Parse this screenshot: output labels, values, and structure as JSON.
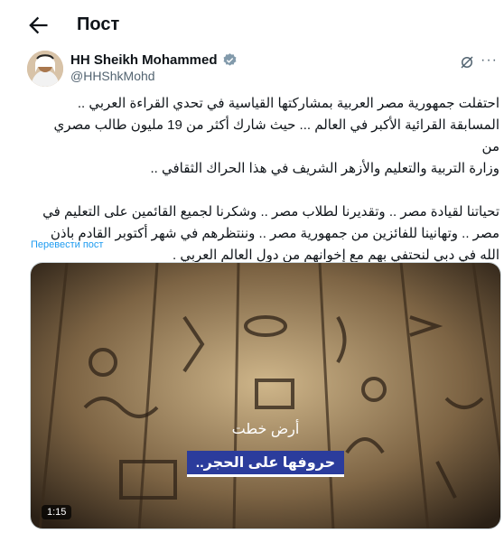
{
  "header": {
    "title": "Пост"
  },
  "author": {
    "name": "HH Sheikh Mohammed",
    "handle": "@HHShkMohd"
  },
  "tweet": {
    "text": "احتفلت جمهورية مصر العربية بمشاركتها القياسية في تحدي القراءة العربي ..\nالمسابقة القرائية الأكبر في العالم ... حيث شارك أكثر من 19 مليون طالب مصري من\nوزارة التربية والتعليم والأزهر الشريف في هذا الحراك الثقافي ..\n\nتحياتنا لقيادة مصر .. وتقديرنا لطلاب مصر .. وشكرنا لجميع القائمين على التعليم في\nمصر .. وتهانينا للفائزين من جمهورية مصر .. وننتظرهم في شهر أكتوبر القادم باذن\nالله في دبي لنحتفي بهم مع إخوانهم من دول العالم العربي ."
  },
  "translate_label": "Перевести пост",
  "video": {
    "caption_line1": "أرض خطت",
    "caption_line2": "حروفها على الحجر..",
    "duration": "1:15"
  },
  "colors": {
    "link": "#1d9bf0",
    "verified": "#829aab",
    "caption_bg": "#2b3c9c"
  },
  "icons": [
    "back-arrow-icon",
    "verified-badge-icon",
    "grok-icon",
    "more-icon"
  ]
}
